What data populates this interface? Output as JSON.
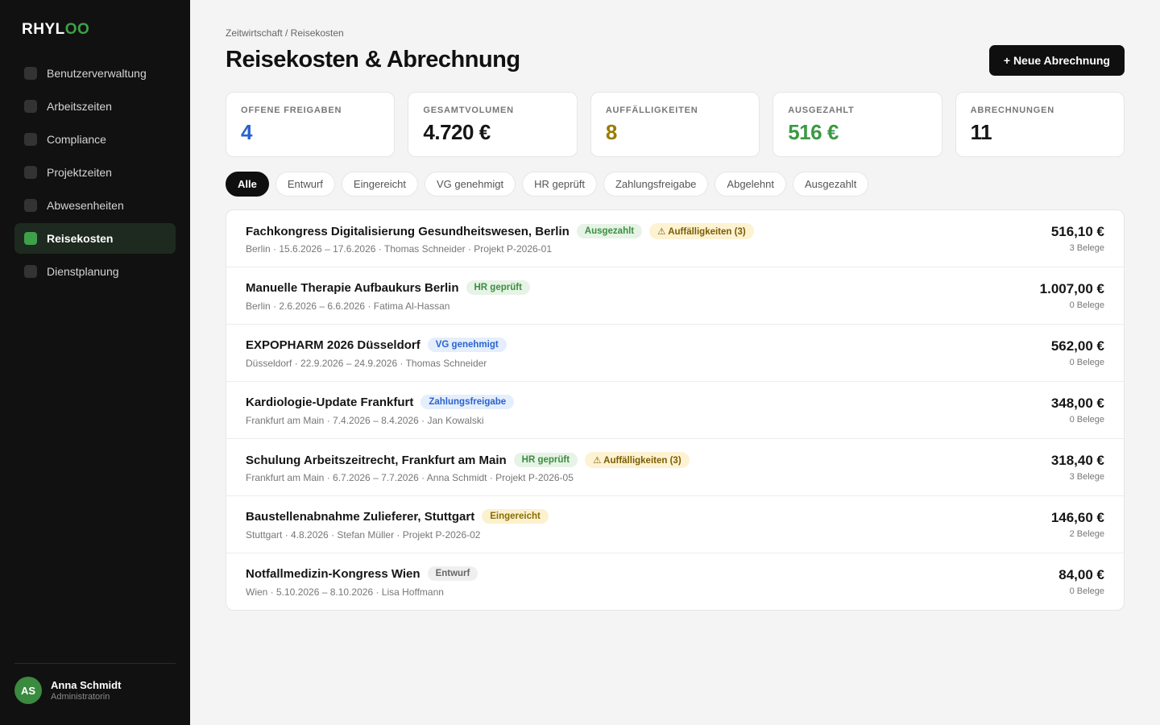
{
  "app": {
    "logo_part1": "RHYL",
    "logo_part2": "OO"
  },
  "sidebar": {
    "items": [
      {
        "label": "Benutzerverwaltung"
      },
      {
        "label": "Arbeitszeiten"
      },
      {
        "label": "Compliance"
      },
      {
        "label": "Projektzeiten"
      },
      {
        "label": "Abwesenheiten"
      },
      {
        "label": "Reisekosten"
      },
      {
        "label": "Dienstplanung"
      }
    ],
    "active": "Reisekosten",
    "user": {
      "initials": "AS",
      "name": "Anna Schmidt",
      "role": "Administratorin"
    }
  },
  "header": {
    "breadcrumb": "Zeitwirtschaft / Reisekosten",
    "title": "Reisekosten & Abrechnung",
    "new_button": "+ Neue Abrechnung"
  },
  "stats": [
    {
      "label": "Offene Freigaben",
      "value": "4",
      "color": "#2a63cf"
    },
    {
      "label": "Gesamtvolumen",
      "value": "4.720 €",
      "color": "#151515"
    },
    {
      "label": "Auffälligkeiten",
      "value": "8",
      "color": "#9a7c00"
    },
    {
      "label": "Ausgezahlt",
      "value": "516 €",
      "color": "#3b9a43"
    },
    {
      "label": "Abrechnungen",
      "value": "11",
      "color": "#151515"
    }
  ],
  "filters": {
    "items": [
      "Alle",
      "Entwurf",
      "Eingereicht",
      "VG genehmigt",
      "HR geprüft",
      "Zahlungsfreigabe",
      "Abgelehnt",
      "Ausgezahlt"
    ],
    "active": "Alle"
  },
  "trips": [
    {
      "title": "Fachkongress Digitalisierung Gesundheitswesen, Berlin",
      "status": "Ausgezahlt",
      "status_style": "green",
      "warning": "⚠ Auffälligkeiten (3)",
      "meta": "Berlin · 15.6.2026 – 17.6.2026 · Thomas Schneider · Projekt P-2026-01",
      "amount": "516,10 €",
      "receipts": "3 Belege"
    },
    {
      "title": "Manuelle Therapie Aufbaukurs Berlin",
      "status": "HR geprüft",
      "status_style": "green",
      "warning": "",
      "meta": "Berlin · 2.6.2026 – 6.6.2026 · Fatima Al-Hassan",
      "amount": "1.007,00 €",
      "receipts": "0 Belege"
    },
    {
      "title": "EXPOPHARM 2026 Düsseldorf",
      "status": "VG genehmigt",
      "status_style": "blue",
      "warning": "",
      "meta": "Düsseldorf · 22.9.2026 – 24.9.2026 · Thomas Schneider",
      "amount": "562,00 €",
      "receipts": "0 Belege"
    },
    {
      "title": "Kardiologie-Update Frankfurt",
      "status": "Zahlungsfreigabe",
      "status_style": "blue",
      "warning": "",
      "meta": "Frankfurt am Main · 7.4.2026 – 8.4.2026 · Jan Kowalski",
      "amount": "348,00 €",
      "receipts": "0 Belege"
    },
    {
      "title": "Schulung Arbeitszeitrecht, Frankfurt am Main",
      "status": "HR geprüft",
      "status_style": "green",
      "warning": "⚠ Auffälligkeiten (3)",
      "meta": "Frankfurt am Main · 6.7.2026 – 7.7.2026 · Anna Schmidt · Projekt P-2026-05",
      "amount": "318,40 €",
      "receipts": "3 Belege"
    },
    {
      "title": "Baustellenabnahme Zulieferer, Stuttgart",
      "status": "Eingereicht",
      "status_style": "yellow",
      "warning": "",
      "meta": "Stuttgart · 4.8.2026 · Stefan Müller · Projekt P-2026-02",
      "amount": "146,60 €",
      "receipts": "2 Belege"
    },
    {
      "title": "Notfallmedizin-Kongress Wien",
      "status": "Entwurf",
      "status_style": "gray",
      "warning": "",
      "meta": "Wien · 5.10.2026 – 8.10.2026 · Lisa Hoffmann",
      "amount": "84,00 €",
      "receipts": "0 Belege"
    }
  ]
}
